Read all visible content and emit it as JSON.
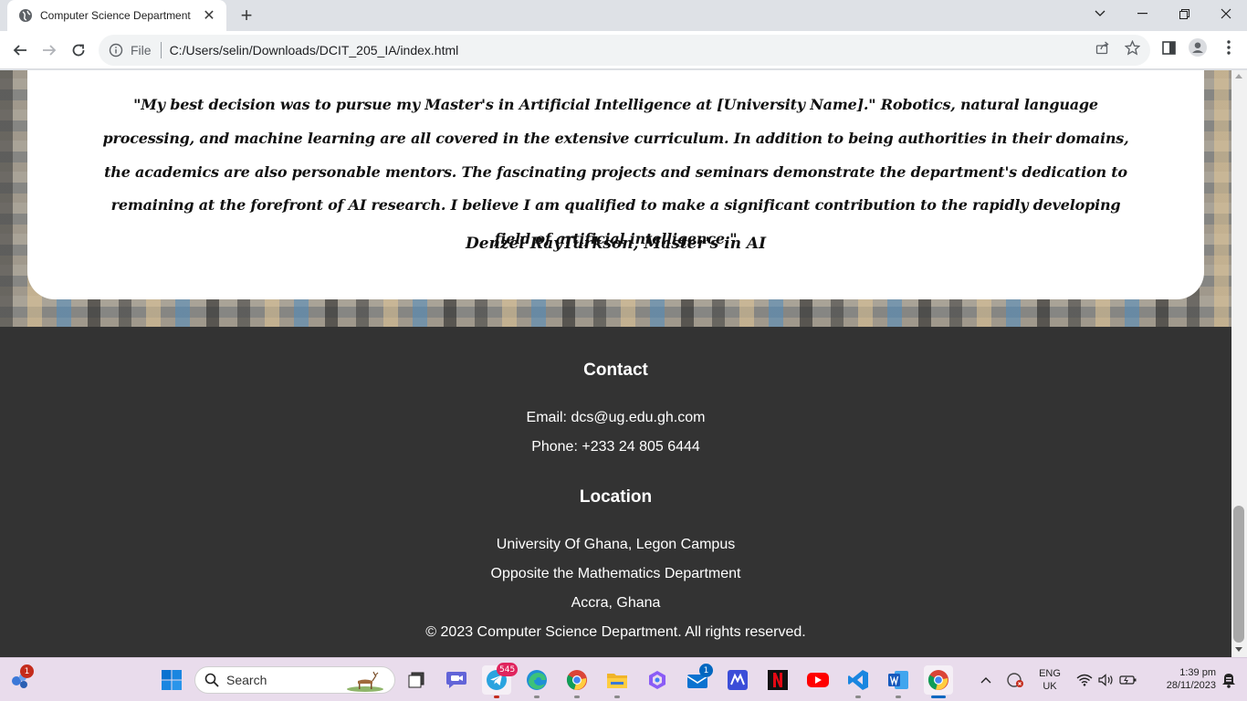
{
  "browser": {
    "tab_title": "Computer Science Department",
    "url_scheme_label": "File",
    "url": "C:/Users/selin/Downloads/DCIT_205_IA/index.html"
  },
  "testimonial": {
    "quote": "\"My best decision was to pursue my Master's in Artificial Intelligence at [University Name].\" Robotics, natural language processing, and machine learning are all covered in the extensive curriculum. In addition to being authorities in their domains, the academics are also personable mentors. The fascinating projects and seminars demonstrate the department's dedication to remaining at the forefront of AI research. I believe I am qualified to make a significant contribution to the rapidly developing field of artificial intelligence.\"",
    "author": "Denzel RayTurkson, Master's in AI"
  },
  "footer": {
    "contact_heading": "Contact",
    "email": "Email: dcs@ug.edu.gh.com",
    "phone": "Phone: +233 24 805 6444",
    "location_heading": "Location",
    "address_line1": "University Of Ghana, Legon Campus",
    "address_line2": "Opposite the Mathematics Department",
    "address_line3": "Accra, Ghana",
    "copyright": "© 2023 Computer Science Department. All rights reserved."
  },
  "taskbar": {
    "search_label": "Search",
    "widgets_badge": "1",
    "telegram_badge": "545",
    "mail_badge": "1",
    "language_line1": "ENG",
    "language_line2": "UK",
    "time": "1:39 pm",
    "date": "28/11/2023"
  },
  "colors": {
    "footer_bg": "#333333",
    "card_bg": "#ffffff",
    "taskbar_bg": "#e9dcec",
    "accent_blue": "#0067c0"
  }
}
